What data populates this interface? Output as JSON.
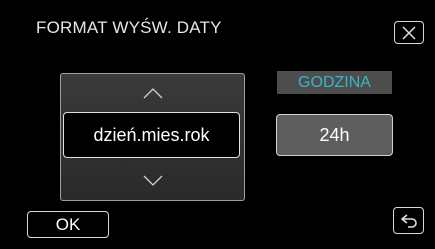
{
  "header": {
    "title": "FORMAT WYŚW. DATY",
    "close_icon": "close-icon"
  },
  "date_format": {
    "up_icon": "chevron-up-icon",
    "down_icon": "chevron-down-icon",
    "value": "dzień.mies.rok"
  },
  "time_format": {
    "label": "GODZINA",
    "value": "24h"
  },
  "footer": {
    "ok_label": "OK",
    "back_icon": "return-icon"
  },
  "colors": {
    "background": "#000000",
    "accent": "#37b6c8",
    "panel": "#4d4d4d"
  }
}
